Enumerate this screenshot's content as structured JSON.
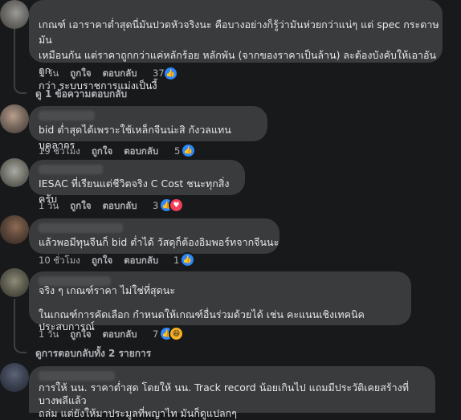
{
  "comments": [
    {
      "text": "เกณฑ์ เอาราคาต่ำสุดนี่มันปวดหัวจริงนะ คือบางอย่างก็รู้ว่ามันห่วยกว่าแน่ๆ แต่ spec กระดาษมัน\nเหมือนกัน แต่ราคาถูกกว่าแค่หลักร้อย หลักพัน (จากของราคาเป็นล้าน) ละต้องบังคับให้เอาอันถูก\nกว่า ระบบราชการแม่งเป็นงี้",
      "time": "1 วัน",
      "like": "ถูกใจ",
      "reply": "ตอบกลับ",
      "reactions": "37",
      "view_replies": "ดู 1 ข้อความตอบกลับ"
    },
    {
      "text": "bid ต่ำสุดได้เพราะใช้เหล็กจีนน่ะสิ กังวลแทนบุคลากร",
      "time": "19 ชั่วโมง",
      "like": "ถูกใจ",
      "reply": "ตอบกลับ",
      "reactions": "5"
    },
    {
      "text": "IESAC ที่เรียนแต่ชีวิตจริง C Cost ชนะทุกสิ่งครับ",
      "time": "1 วัน",
      "like": "ถูกใจ",
      "reply": "ตอบกลับ",
      "reactions": "3"
    },
    {
      "text": "แล้วพอมีทุนจีนก็ bid ต่ำได้ วัสดุก็ต้องอิมพอร์ทจากจีนนะ",
      "time": "10 ชั่วโมง",
      "like": "ถูกใจ",
      "reply": "ตอบกลับ",
      "reactions": "1"
    },
    {
      "text": "จริง ๆ เกณฑ์ราคา ไม่ใช่ที่สุดนะ\n\nในเกณฑ์การคัดเลือก กำหนดให้เกณฑ์อื่นร่วมด้วยได้ เช่น คะแนนเชิงเทคนิค ประสบการณ์",
      "time": "1 วัน",
      "like": "ถูกใจ",
      "reply": "ตอบกลับ",
      "reactions": "7",
      "view_replies": "ดูการตอบกลับทั้ง 2 รายการ"
    },
    {
      "text": "การให้ นน. ราคาต่ำสุด โดยให้ นน. Track record น้อยเกินไป แถมมีประวัติเคยสร้างที่บางพลีแล้ว\nถล่ม แต่ยังให้มาประมูลที่พญาไท มันก็ดูแปลกๆ"
    }
  ],
  "colors": {
    "bg": "#18191a",
    "bubble": "#3a3b3c",
    "text": "#e4e6eb",
    "meta": "#b0b3b8",
    "like": "#2d88ff",
    "love": "#f33e58",
    "haha": "#f7b125"
  }
}
